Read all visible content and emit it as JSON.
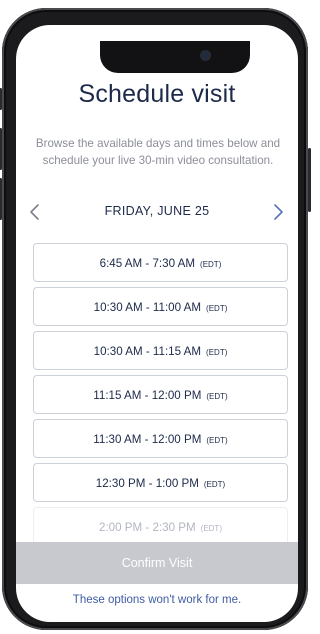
{
  "page": {
    "title": "Schedule visit",
    "subtitle": "Browse the available days and times below and schedule your live 30-min video consultation."
  },
  "date_nav": {
    "date_label": "FRIDAY, JUNE 25",
    "prev_icon": "chevron-left-icon",
    "next_icon": "chevron-right-icon"
  },
  "slots": [
    {
      "time": "6:45 AM - 7:30 AM",
      "tz": "(EDT)"
    },
    {
      "time": "10:30 AM - 11:00 AM",
      "tz": "(EDT)"
    },
    {
      "time": "10:30 AM - 11:15 AM",
      "tz": "(EDT)"
    },
    {
      "time": "11:15 AM - 12:00 PM",
      "tz": "(EDT)"
    },
    {
      "time": "11:30 AM - 12:00 PM",
      "tz": "(EDT)"
    },
    {
      "time": "12:30 PM - 1:00 PM",
      "tz": "(EDT)"
    },
    {
      "time": "2:00 PM - 2:30 PM",
      "tz": "(EDT)"
    }
  ],
  "actions": {
    "confirm_label": "Confirm Visit",
    "no_options_label": "These options won't work for me."
  },
  "colors": {
    "primary_text": "#1d2a4a",
    "link": "#3f5ba4",
    "arrow_inactive": "#7d808a",
    "arrow_active": "#5a75b8",
    "confirm_disabled": "#c8c9ce"
  }
}
